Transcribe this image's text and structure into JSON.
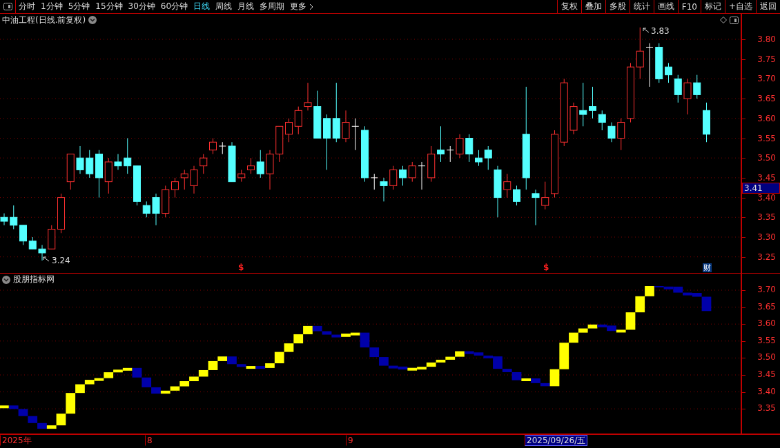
{
  "toolbar": {
    "periods": [
      {
        "label": "分时",
        "selected": false
      },
      {
        "label": "1分钟",
        "selected": false
      },
      {
        "label": "5分钟",
        "selected": false
      },
      {
        "label": "15分钟",
        "selected": false
      },
      {
        "label": "30分钟",
        "selected": false
      },
      {
        "label": "60分钟",
        "selected": false
      },
      {
        "label": "日线",
        "selected": true
      },
      {
        "label": "周线",
        "selected": false
      },
      {
        "label": "月线",
        "selected": false
      },
      {
        "label": "多周期",
        "selected": false
      }
    ],
    "more": "更多",
    "buttons": [
      "复权",
      "叠加",
      "多股",
      "统计",
      "画线",
      "F10",
      "标记",
      "+自选",
      "返回"
    ]
  },
  "main_chart": {
    "title": "中油工程(日线.前复权)",
    "high_label": "3.83",
    "low_label": "3.24",
    "signal_marks": [
      "$",
      "$"
    ],
    "finance_badge": "财",
    "price_tag": "3.41",
    "y_labels": [
      "3.80",
      "3.75",
      "3.70",
      "3.65",
      "3.60",
      "3.55",
      "3.50",
      "3.45",
      "3.40",
      "3.35",
      "3.30",
      "3.25"
    ]
  },
  "indicator": {
    "title": "股朋指标网",
    "y_labels": [
      "3.70",
      "3.65",
      "3.60",
      "3.55",
      "3.50",
      "3.45",
      "3.40",
      "3.35"
    ]
  },
  "time_axis": {
    "labels": [
      {
        "text": "2025年",
        "highlighted": false
      },
      {
        "text": "8",
        "highlighted": false
      },
      {
        "text": "9",
        "highlighted": false
      },
      {
        "text": "2025/09/26/五",
        "highlighted": true
      }
    ]
  }
}
